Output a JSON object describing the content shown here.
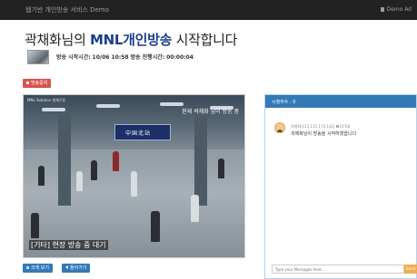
{
  "navbar": {
    "brand": "웹기반 개인방송 서비스 Demo",
    "right_link": "Demo Ad"
  },
  "header": {
    "title_name": "곽채화님의 ",
    "title_accent": "MNL개인방송",
    "title_suffix": " 시작합니다",
    "start_label": "방송 시작시간:",
    "start_value": "10/06 10:58",
    "elapsed_label": "방송 진행시간:",
    "elapsed_value": "00:00:04"
  },
  "controls": {
    "stop_label": "방송중지"
  },
  "video": {
    "osd_top_left": "MNL Solution 현재구동",
    "osd_top_right": "현재 곽채화 님이 방송 중",
    "station_sign": "中国北站",
    "caption": "[기타] 현장 방송 중 대기"
  },
  "bottom_buttons": {
    "view_label": "크게 보기",
    "back_label": "돌아가기"
  },
  "chat": {
    "header_label": "시청자수 : 0",
    "message": {
      "meta": "곽채화(111.111.174.142)",
      "time": "10:58",
      "text": "곽채화님이 방송을 시작하였습니다"
    },
    "input_placeholder": "Type your Messages here...",
    "send_label": "Send"
  },
  "colors": {
    "navbar": "#222222",
    "primary": "#337ab7",
    "danger": "#d9534f",
    "warning": "#f0ad4e",
    "title_accent": "#1a3e8c"
  }
}
